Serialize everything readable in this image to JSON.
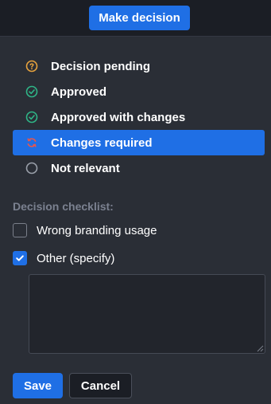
{
  "header": {
    "make_decision_label": "Make decision"
  },
  "statuses": [
    {
      "label": "Decision pending",
      "icon": "question-circle-icon",
      "color": "#e8a33d",
      "selected": false
    },
    {
      "label": "Approved",
      "icon": "check-circle-icon",
      "color": "#2fb587",
      "selected": false
    },
    {
      "label": "Approved with changes",
      "icon": "check-circle-icon",
      "color": "#2fb587",
      "selected": false
    },
    {
      "label": "Changes required",
      "icon": "refresh-icon",
      "color": "#e5564f",
      "selected": true
    },
    {
      "label": "Not relevant",
      "icon": "empty-circle-icon",
      "color": "#9aa0aa",
      "selected": false
    }
  ],
  "checklist": {
    "title": "Decision checklist:",
    "items": [
      {
        "label": "Wrong branding usage",
        "checked": false
      },
      {
        "label": "Other (specify)",
        "checked": true
      }
    ],
    "other_text": ""
  },
  "actions": {
    "save_label": "Save",
    "cancel_label": "Cancel"
  },
  "colors": {
    "accent": "#1f6fe5",
    "panel": "#2a2e36",
    "background": "#1b1e25"
  }
}
